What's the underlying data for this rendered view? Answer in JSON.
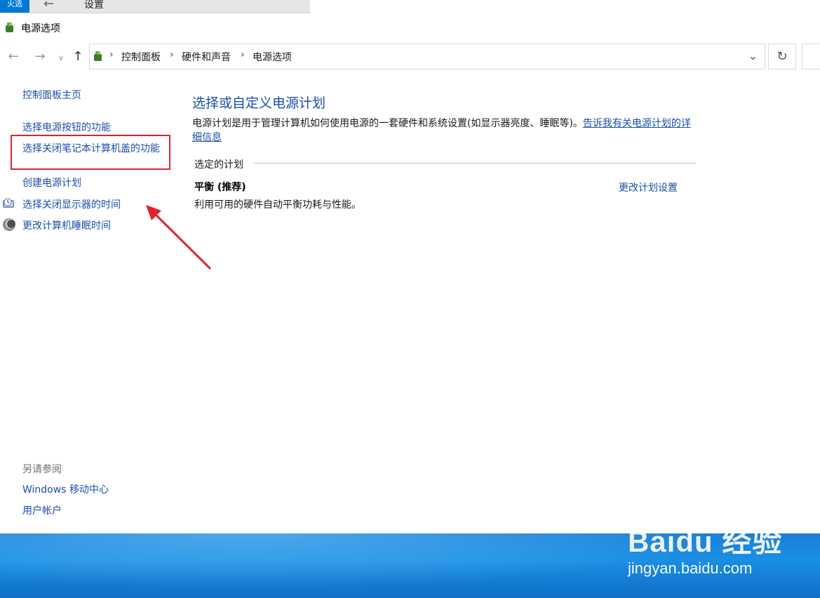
{
  "background_window": {
    "title": "设置",
    "badge": "火选"
  },
  "window": {
    "title": "电源选项"
  },
  "address": {
    "crumbs": [
      "控制面板",
      "硬件和声音",
      "电源选项"
    ]
  },
  "left_pane": {
    "home": "控制面板主页",
    "items": [
      {
        "label": "选择电源按钮的功能"
      },
      {
        "label": "选择关闭笔记本计算机盖的功能"
      },
      {
        "label": "创建电源计划"
      },
      {
        "label": "选择关闭显示器的时间",
        "icon": "monitor-clock-icon"
      },
      {
        "label": "更改计算机睡眠时间",
        "icon": "moon-icon"
      }
    ],
    "see_also_title": "另请参阅",
    "see_also": [
      {
        "label": "Windows 移动中心"
      },
      {
        "label": "用户帐户"
      }
    ]
  },
  "main": {
    "heading": "选择或自定义电源计划",
    "description": "电源计划是用于管理计算机如何使用电源的一套硬件和系统设置(如显示器亮度、睡眠等)。",
    "description_link": "告诉我有关电源计划的详细信息",
    "section_label": "选定的计划",
    "plan": {
      "name": "平衡 (推荐)",
      "description": "利用可用的硬件自动平衡功耗与性能。",
      "change_link": "更改计划设置"
    }
  },
  "watermark": {
    "brand": "Baidu 经验",
    "url": "jingyan.baidu.com"
  },
  "colors": {
    "link": "#1a4fa8",
    "annotation_red": "#e0242a",
    "desktop_blue": "#1a8fe3"
  }
}
